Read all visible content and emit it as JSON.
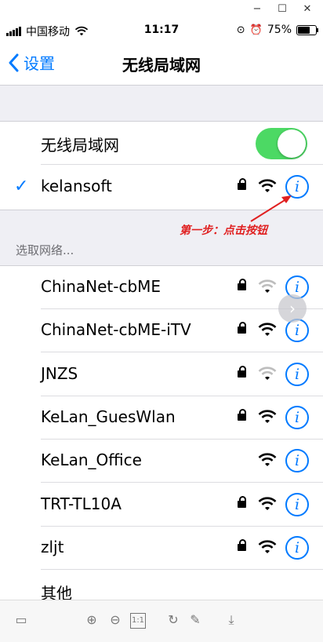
{
  "window_controls": {
    "minimize": "−",
    "maximize": "☐",
    "close": "✕"
  },
  "status_bar": {
    "carrier": "中国移动",
    "time": "11:17",
    "battery": "75%",
    "battery_level": 0.75
  },
  "nav": {
    "back_label": "设置",
    "title": "无线局域网"
  },
  "wlan_toggle": {
    "label": "无线局域网",
    "on": true
  },
  "connected": {
    "name": "kelansoft",
    "secured": true
  },
  "annotation": "第一步：点击按钮",
  "section_header": "选取网络...",
  "networks": [
    {
      "name": "ChinaNet-cbME",
      "secured": true,
      "signal": "medium"
    },
    {
      "name": "ChinaNet-cbME-iTV",
      "secured": true,
      "signal": "full"
    },
    {
      "name": "JNZS",
      "secured": true,
      "signal": "medium"
    },
    {
      "name": "KeLan_GuesWlan",
      "secured": true,
      "signal": "full"
    },
    {
      "name": "KeLan_Office",
      "secured": false,
      "signal": "full"
    },
    {
      "name": "TRT-TL10A",
      "secured": true,
      "signal": "full"
    },
    {
      "name": "zljt",
      "secured": true,
      "signal": "full"
    }
  ],
  "other_label": "其他",
  "toolbar": {
    "zoom_reset_label": "1:1"
  },
  "colors": {
    "accent": "#007aff",
    "toggle_on": "#4cd964",
    "annotation": "#e02020"
  }
}
